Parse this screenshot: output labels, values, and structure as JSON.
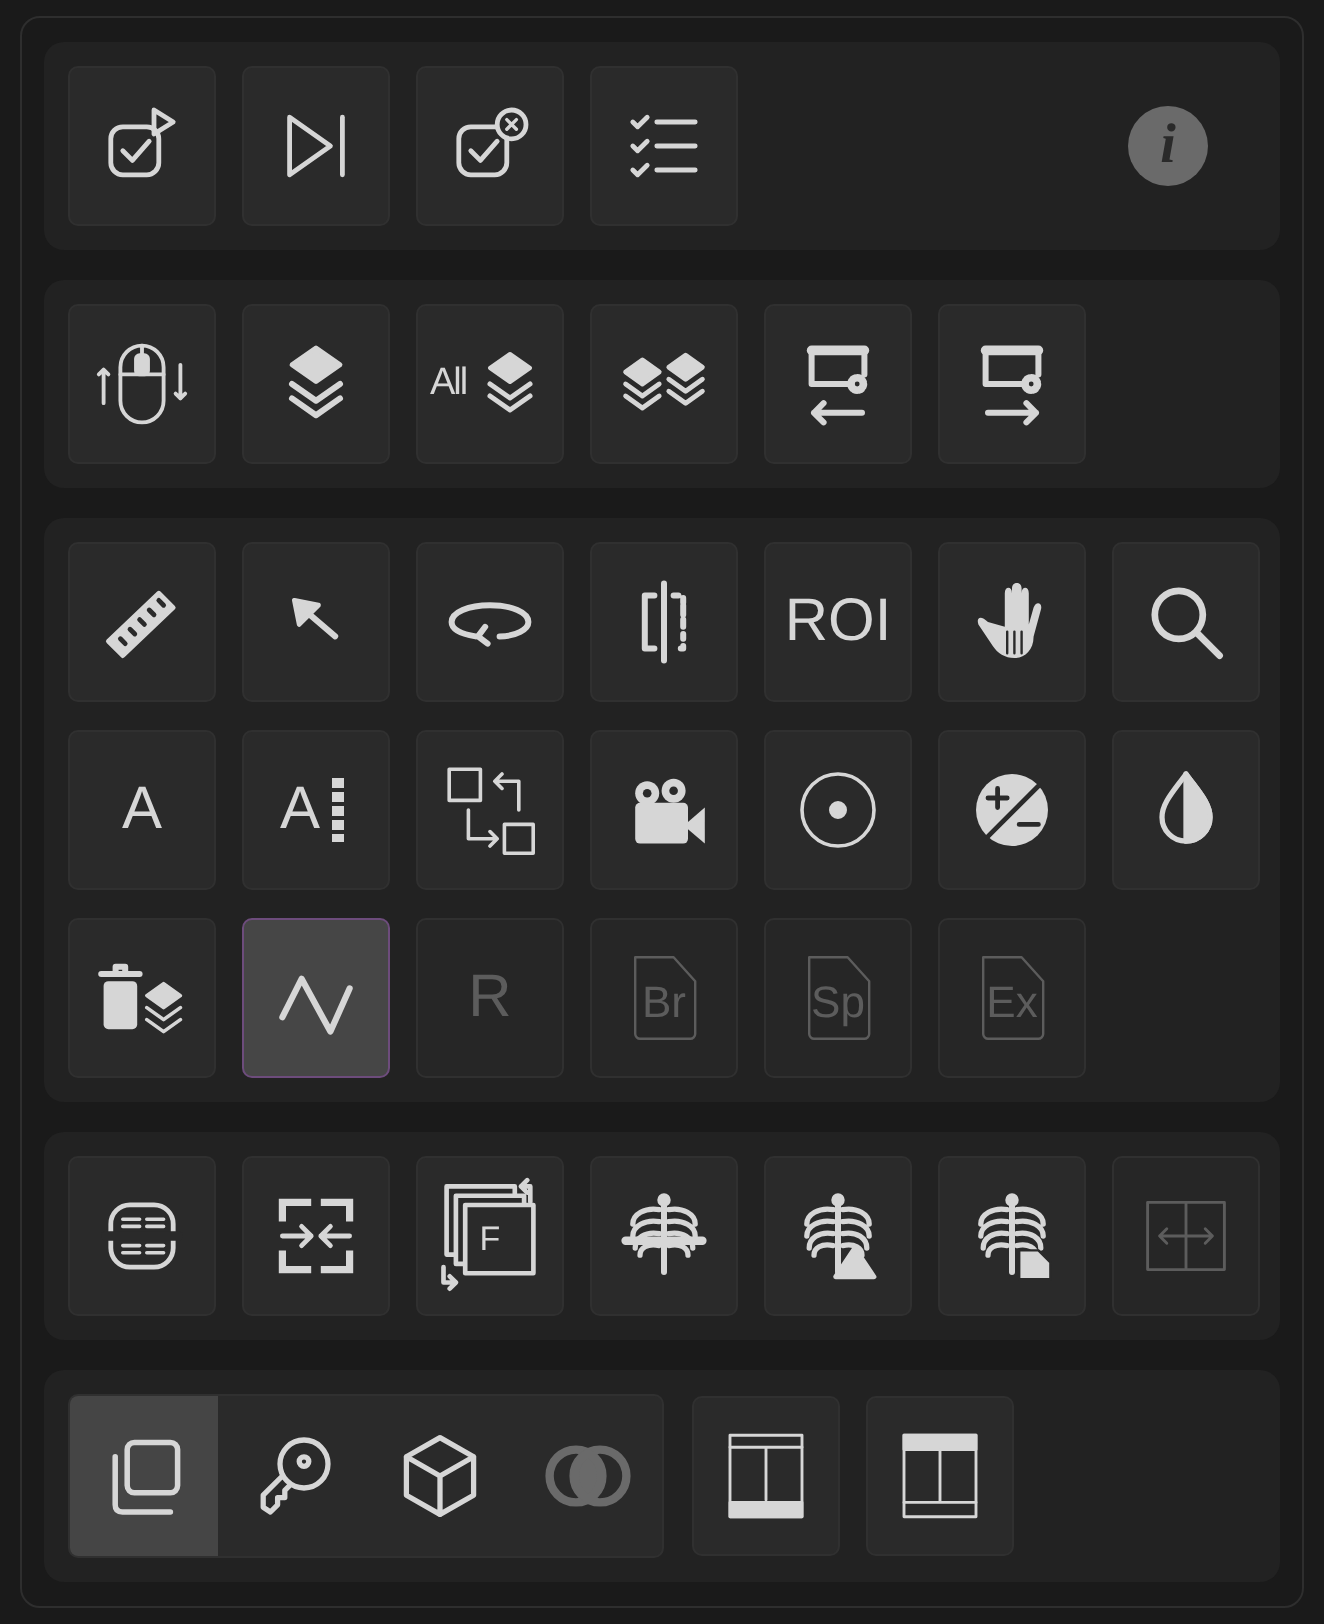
{
  "groups": [
    {
      "buttons": [
        {
          "kind": "check-play",
          "selected": false,
          "disabled": false
        },
        {
          "kind": "play-next",
          "selected": false,
          "disabled": false
        },
        {
          "kind": "check-cancel",
          "selected": false,
          "disabled": false
        },
        {
          "kind": "checklist",
          "selected": false,
          "disabled": false
        }
      ],
      "info": {
        "label": "i"
      }
    },
    {
      "buttons": [
        {
          "kind": "mouse-scroll",
          "selected": false,
          "disabled": false
        },
        {
          "kind": "layers",
          "selected": false,
          "disabled": false
        },
        {
          "kind": "layers",
          "label": "All",
          "selected": false,
          "disabled": false
        },
        {
          "kind": "layers-double",
          "selected": false,
          "disabled": false
        },
        {
          "kind": "window-gear-left",
          "selected": false,
          "disabled": false
        },
        {
          "kind": "window-gear-right",
          "selected": false,
          "disabled": false
        }
      ]
    },
    {
      "buttons": [
        {
          "kind": "ruler",
          "selected": false,
          "disabled": false
        },
        {
          "kind": "arrow",
          "selected": false,
          "disabled": false
        },
        {
          "kind": "rotate",
          "selected": false,
          "disabled": false
        },
        {
          "kind": "flip",
          "selected": false,
          "disabled": false
        },
        {
          "kind": "text",
          "label": "ROI",
          "selected": false,
          "disabled": false
        },
        {
          "kind": "hand",
          "selected": false,
          "disabled": false
        },
        {
          "kind": "search",
          "selected": false,
          "disabled": false
        },
        {
          "kind": "text",
          "label": "A",
          "selected": false,
          "disabled": false
        },
        {
          "kind": "text-ruler",
          "label": "A",
          "selected": false,
          "disabled": false
        },
        {
          "kind": "swap-boxes",
          "selected": false,
          "disabled": false
        },
        {
          "kind": "camera",
          "selected": false,
          "disabled": false
        },
        {
          "kind": "target",
          "selected": false,
          "disabled": false
        },
        {
          "kind": "exposure",
          "selected": false,
          "disabled": false
        },
        {
          "kind": "contrast",
          "selected": false,
          "disabled": false
        },
        {
          "kind": "delete-layers",
          "selected": false,
          "disabled": false
        },
        {
          "kind": "zigzag",
          "selected": true,
          "disabled": false
        },
        {
          "kind": "text",
          "label": "R",
          "selected": false,
          "disabled": true
        },
        {
          "kind": "file",
          "label": "Br",
          "selected": false,
          "disabled": true
        },
        {
          "kind": "file",
          "label": "Sp",
          "selected": false,
          "disabled": true
        },
        {
          "kind": "file",
          "label": "Ex",
          "selected": false,
          "disabled": true
        }
      ]
    },
    {
      "buttons": [
        {
          "kind": "scan-lines",
          "selected": false,
          "disabled": false
        },
        {
          "kind": "compress",
          "selected": false,
          "disabled": false
        },
        {
          "kind": "frames",
          "label": "F",
          "selected": false,
          "disabled": false
        },
        {
          "kind": "ribcage-split",
          "selected": false,
          "disabled": false
        },
        {
          "kind": "ribcage-triangle",
          "selected": false,
          "disabled": false
        },
        {
          "kind": "ribcage-file",
          "selected": false,
          "disabled": false
        },
        {
          "kind": "split-arrows",
          "selected": false,
          "disabled": true
        }
      ]
    },
    {
      "segments": [
        {
          "kind": "copy",
          "selected": true,
          "disabled": false
        },
        {
          "kind": "key",
          "selected": false,
          "disabled": false
        },
        {
          "kind": "cube",
          "selected": false,
          "disabled": false
        },
        {
          "kind": "overlap",
          "selected": false,
          "disabled": true
        }
      ],
      "buttons": [
        {
          "kind": "layout-bottom",
          "selected": false,
          "disabled": false
        },
        {
          "kind": "layout-top",
          "selected": false,
          "disabled": false
        }
      ]
    }
  ]
}
